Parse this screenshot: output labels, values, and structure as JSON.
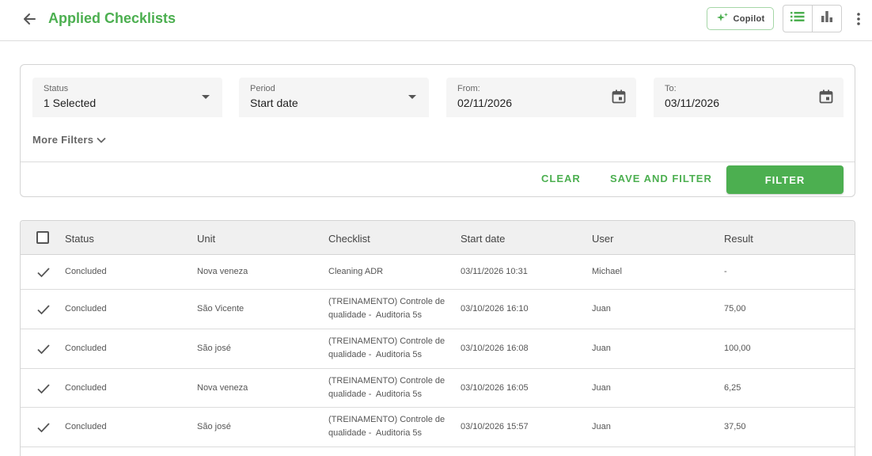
{
  "header": {
    "title": "Applied Checklists",
    "copilot_label": "Copilot",
    "icons": [
      "back-arrow-icon",
      "sparkle-icon",
      "list-view-icon",
      "bar-chart-icon",
      "more-vertical-icon"
    ],
    "accent_color": "#4caf50"
  },
  "filters": {
    "status": {
      "label": "Status",
      "value": "1 Selected"
    },
    "period": {
      "label": "Period",
      "value": "Start date"
    },
    "from": {
      "label": "From:",
      "value": "02/11/2026"
    },
    "to": {
      "label": "To:",
      "value": "03/11/2026"
    },
    "more_filters": "More Filters",
    "clear": "CLEAR",
    "save_and_filter": "SAVE AND FILTER",
    "filter": "FILTER"
  },
  "table": {
    "columns": [
      "Status",
      "Unit",
      "Checklist",
      "Start date",
      "User",
      "Result"
    ],
    "rows": [
      {
        "status": "Concluded",
        "unit": "Nova veneza",
        "checklist_line1": "Cleaning ADR",
        "checklist_line2": "",
        "start_date": "03/11/2026 10:31",
        "user": "Michael",
        "result": "-"
      },
      {
        "status": "Concluded",
        "unit": "São Vicente",
        "checklist_line1": "(TREINAMENTO) Controle de",
        "checklist_line2": "qualidade -  Auditoria 5s",
        "start_date": "03/10/2026 16:10",
        "user": "Juan",
        "result": "75,00"
      },
      {
        "status": "Concluded",
        "unit": "São josé",
        "checklist_line1": "(TREINAMENTO) Controle de",
        "checklist_line2": "qualidade -  Auditoria 5s",
        "start_date": "03/10/2026 16:08",
        "user": "Juan",
        "result": "100,00"
      },
      {
        "status": "Concluded",
        "unit": "Nova veneza",
        "checklist_line1": "(TREINAMENTO) Controle de",
        "checklist_line2": "qualidade -  Auditoria 5s",
        "start_date": "03/10/2026 16:05",
        "user": "Juan",
        "result": "6,25"
      },
      {
        "status": "Concluded",
        "unit": "São josé",
        "checklist_line1": "(TREINAMENTO) Controle de",
        "checklist_line2": "qualidade -  Auditoria 5s",
        "start_date": "03/10/2026 15:57",
        "user": "Juan",
        "result": "37,50"
      }
    ]
  }
}
